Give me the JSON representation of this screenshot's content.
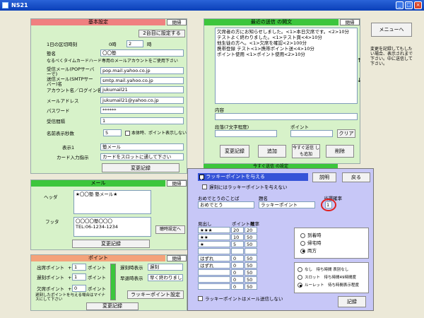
{
  "window": {
    "title": "NS21"
  },
  "basic": {
    "header": "基本設定",
    "close": "閉帰",
    "today_btn": "2台目に設定する",
    "row1_label": "1日の区切時刻",
    "row1_prefix": "0時",
    "row1_value": "2",
    "row1_suffix": "時",
    "store_label": "塾名",
    "store_value": "〇〇塾",
    "note": "なるべくタイムカードハード専用のメールアカウントをご使用下さい",
    "pop_label": "受信メール(POPサーバ ーで)",
    "pop_value": "pop.mail.yahoo.co.jp",
    "smtp_label": "送信メール(SMTPサー バー)名",
    "smtp_value": "smtp.mail.yahoo.co.jp",
    "account_label": "アカウント名／ログイン名",
    "account_value": "jukumail21",
    "mail_label": "メールアドレス",
    "mail_value": "jukumail21@yahoo.co.jp",
    "pass_label": "パスワード",
    "pass_value": "******",
    "interval_label": "受信間隔",
    "interval_value": "1",
    "display_label": "名前表示秒数",
    "display_value": "5",
    "display_chk": "本体時、ポイント表示しない",
    "disp1_label": "表示1",
    "disp1_value": "塾メール",
    "card_label": "カード入力指示",
    "card_value": "カードをスロットに通して下さい",
    "change_btn": "変更記録"
  },
  "mail": {
    "header": "メール",
    "close": "閉帰",
    "header_label": "ヘッダ",
    "header_text": "★〇〇塾 塾メール★",
    "footer_label": "フッタ",
    "footer_text1": "〇〇〇〇塾〇〇〇",
    "footer_text2": "TEL:06-1234-1234",
    "send_setting": "聴時設定へ",
    "change_btn": "変更記録"
  },
  "point": {
    "header": "ポイント",
    "close": "閉帰",
    "attend_label": "出席ポイント",
    "attend_plus": "+",
    "attend_value": "1",
    "attend_unit": "ポイント",
    "late_label": "遅刻ポイント",
    "late_plus": "+",
    "late_value": "1",
    "late_unit": "ポイント",
    "absent_label": "欠席ポイント",
    "absent_plus": "+",
    "absent_value": "0",
    "absent_unit": "ポイント",
    "note": "遅刻したポイントを与える場合はマイナスにして下さい",
    "late_disp_label": "遅刻時表示",
    "late_disp_value": "遅刻",
    "early_disp_label": "早退時表示",
    "early_disp_value": "早く終わりました",
    "lucky_btn": "ラッキーポイント設定",
    "change_btn": "変更記録"
  },
  "history": {
    "header": "最近の送信 の開文",
    "close": "閉帰",
    "lines": [
      "欠席者の方にお知らせしました。<1>本日欠席です。<2>10分",
      "テストよく終わりました。<1>テスト頁<4>10分",
      "他生徒の方へ。<1>欠席を確認<2>100分",
      "携帯登録 テスト<1>携帯ポイント送<4>10分",
      "ポイント使用 <1>ポイント使用<2>10分"
    ],
    "body_label": "内容",
    "subject_label": "段落(7文字程度)",
    "point_label": "ポイント",
    "clear_btn": "クリア",
    "change_btn": "変更記録",
    "add_btn": "追加",
    "send_btn": "今すぐ送信 しも追加",
    "delete_btn": "削除"
  },
  "side": {
    "menu_btn": "メニューへ",
    "note": "変更を記録してもしたい場合、表示されまで下さい。中に送信して下さい。"
  },
  "lucky": {
    "caption": "今すぐ送信 の設定",
    "enable": "ラッキーポイントを与える",
    "close_btn": "説明",
    "back_btn": "戻る",
    "sub_chk": "遅刻にはラッキーポイントを与えない",
    "msg_label": "おめでとうのことば",
    "msg_value": "おめでとう",
    "title_label": "題名",
    "title_value": "ラッキーポイント",
    "prob_label": "当選確率",
    "prob_value": "1",
    "col_name": "見出し",
    "col_points": "ポイント数",
    "col_prob": "確率",
    "rows": [
      {
        "name": "★★★",
        "p": "20",
        "q": "20"
      },
      {
        "name": "★★",
        "p": "10",
        "q": "50"
      },
      {
        "name": "★",
        "p": "5",
        "q": "50"
      },
      {
        "name": "",
        "p": "",
        "q": ""
      },
      {
        "name": "はずれ",
        "p": "0",
        "q": "50"
      },
      {
        "name": "はずれ",
        "p": "0",
        "q": "50"
      },
      {
        "name": "",
        "p": "0",
        "q": "50"
      },
      {
        "name": "",
        "p": "0",
        "q": "50"
      },
      {
        "name": "",
        "p": "0",
        "q": "50"
      }
    ],
    "timing": [
      "到着時",
      "帰宅時",
      "両方"
    ],
    "timing_selected": 2,
    "mode": [
      "なし　待ち時間 表別なし",
      "スロット　待ち時間49時間度",
      "ルーレット　待ち時間表示程度"
    ],
    "mode_selected": 2,
    "mail_chk": "ラッキーポイントはメール送信しない",
    "save_btn": "記録"
  },
  "colors": {
    "accent": "#3CC63C",
    "circle": "#E02020"
  }
}
